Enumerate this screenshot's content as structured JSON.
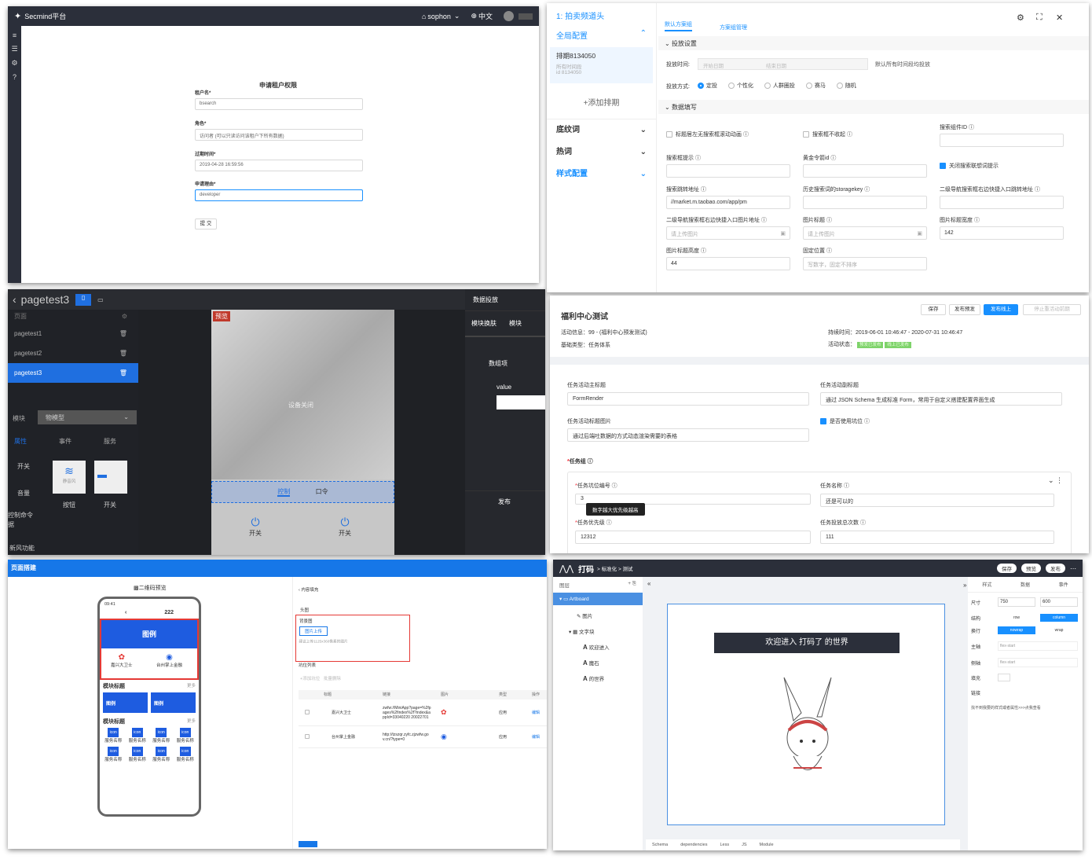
{
  "p1": {
    "brand": "Secmind平台",
    "user": "sophon",
    "lang": "中文",
    "title": "申请租户权限",
    "tenant_label": "租户名*",
    "tenant_value": "bsearch",
    "role_label": "角色*",
    "role_value": "访问者 (可以只读访问该租户下所有数据)",
    "expire_label": "过期时间*",
    "expire_value": "2019-04-28 16:59:56",
    "reason_label": "申请理由*",
    "reason_value": "developer",
    "submit": "提 交"
  },
  "p2": {
    "left": {
      "item1": "1: 拍卖频道头",
      "global": "全局配置",
      "schedule_title": "排期8134050",
      "schedule_sub1": "所有时间段",
      "schedule_sub2": "id 8134050",
      "add": "+添加排期",
      "bottom_word": "底纹词",
      "hot": "热词",
      "style": "样式配置"
    },
    "tabs": [
      "默认方案组",
      "方案组管理"
    ],
    "sec1": "投放设置",
    "sec2": "数据填写",
    "time_label": "投放时间:",
    "start_ph": "开始日期",
    "end_ph": "结束日期",
    "all_time": "默认所有时间段均投放",
    "mode_label": "投放方式:",
    "modes": [
      "定投",
      "个性化",
      "人群圈投",
      "赛马",
      "随机"
    ],
    "chk1": "标题居左无搜索框滚动动画",
    "chk2": "搜索框不收起",
    "comp_id_label": "搜索组件ID",
    "hint_label": "搜索框提示",
    "gold_label": "黄金令箭id",
    "close_suggest": "关闭搜索联想词提示",
    "jump_label": "搜索跳转地址",
    "jump_value": "//market.m.taobao.com/app/pm",
    "history_label": "历史搜索词的storagekey",
    "nav_jump_label": "二级导航搜索框右边快捷入口跳转地址",
    "nav_img_label": "二级导航搜索框右边快捷入口图片地址",
    "upload_ph": "请上传图片",
    "img_title_label": "图片标题",
    "img_title_ph": "请上传图片",
    "img_width_label": "图片标题宽度",
    "img_width_value": "142",
    "img_height_label": "图片标题高度",
    "img_height_value": "44",
    "fixed_label": "固定位置",
    "fixed_ph": "写数字，固定不排序"
  },
  "p3": {
    "title": "pagetest3",
    "pages_label": "页面",
    "pages": [
      "pagetest1",
      "pagetest2",
      "pagetest3"
    ],
    "module_label": "模块",
    "module_value": "物模型",
    "tabs": [
      "属性",
      "事件",
      "服务"
    ],
    "switch_label": "开关",
    "volume_label": "音量",
    "ctrl_label": "控制命令",
    "ctrl_label2": "据",
    "wind_label": "新风功能",
    "comp1_caption": "静音风",
    "comp1": "按钮",
    "comp2": "开关",
    "preview_badge": "预览",
    "device_off": "设备关闭",
    "ctrl_tab": "控制",
    "cmd_tab": "口令",
    "open1": "开关",
    "open2": "开关",
    "right_title": "数据投放",
    "right_tab": "模块换肤",
    "right_tab2": "模块",
    "data_item": "数组项",
    "value_label": "value",
    "publish": "发布"
  },
  "p4": {
    "buttons": [
      "保存",
      "发布预发",
      "发布线上",
      "停止重活动前期"
    ],
    "title": "福利中心测试",
    "info": "活动信息：99 - (福利中心预发测试)",
    "base_type": "基础类型：任务体系",
    "duration": "持续时间：2019-06-01 10:46:47 - 2020-07-31 10:46:47",
    "status_label": "活动状态：",
    "status_tags": [
      "预发已发布",
      "线上已发布"
    ],
    "main_title_label": "任务活动主标题",
    "main_title_value": "FormRender",
    "sub_title_label": "任务活动副标题",
    "sub_title_value": "通过 JSON Schema 生成标准 Form，常用于自定义搭建配置界面生成",
    "img_label": "任务活动标题图片",
    "img_value": "通过后端吐数据的方式动态渲染需要的表格",
    "use_slot": "是否使用坑位",
    "group_label": "任务组",
    "slot_no_label": "任务坑位编号",
    "slot_no_value": "3",
    "tooltip": "数字越大优先级越高",
    "name_label": "任务名称",
    "name_value": "还是可以的",
    "priority_label": "任务优先级",
    "priority_value": "12312",
    "count_label": "任务投放总次数",
    "count_value": "111"
  },
  "p5": {
    "header": "页面搭建",
    "qr": "二维码预览",
    "time": "09:41",
    "nav_title": "222",
    "banner": "图例",
    "item1": "嘉兴大卫士",
    "item2": "台州掌上金融",
    "mod1": "模块标题",
    "more1": "更多",
    "b1": "图例",
    "b2": "图例",
    "mod2": "模块标题",
    "more2": "更多",
    "icon": "icon",
    "svc": "服务名称",
    "right_back": "内容填充",
    "head_label": "头图",
    "bg_label": "背景图",
    "upload_btn": "图片上传",
    "upload_tip": "建议上传1125x360像素的图片",
    "list_label": "坑位列表",
    "list_btn1": "+添加坑位",
    "list_btn2": "批量删除",
    "cols": [
      "标题",
      "链接",
      "图片",
      "类型",
      "操作"
    ],
    "rows": [
      {
        "title": "嘉兴大卫士",
        "link": "zwfw://MiniApp?page=%2fpages%2findex%2f?index&appId=33040220 20022701",
        "type": "应用",
        "op": "编辑"
      },
      {
        "title": "台州掌上金融",
        "link": "http://tzszqr.zyfc.zjzwfw.gov.cn/?type=0",
        "type": "应用",
        "op": "编辑"
      }
    ]
  },
  "p6": {
    "logo": "打码",
    "crumb": "> 标准化 > 测试",
    "save": "保存",
    "preview": "预览",
    "publish": "发布",
    "layers": "图层",
    "artboard": "Artboard",
    "img_layer": "图片",
    "text_group": "文字块",
    "t1": "欢迎进入",
    "t2": "魔石",
    "t3": "的世界",
    "banner": "欢迎进入 打码了 的世界",
    "tabs": [
      "样式",
      "数据",
      "事件"
    ],
    "size_label": "尺寸",
    "w": "750",
    "h": "600",
    "struct_label": "结构",
    "row": "row",
    "column": "column",
    "wrap_label": "换行",
    "nowrap": "nowrap",
    "wrap": "wrap",
    "main_label": "主轴",
    "main_value": "flex-start",
    "cross_label": "侧轴",
    "cross_value": "flex-start",
    "fill_label": "填充",
    "link_label": "链接",
    "help": "找不到我要的样式或者属性>>>点我查看",
    "bottom_tabs": [
      "Schema",
      "dependencies",
      "Less",
      "JS",
      "Module"
    ]
  }
}
